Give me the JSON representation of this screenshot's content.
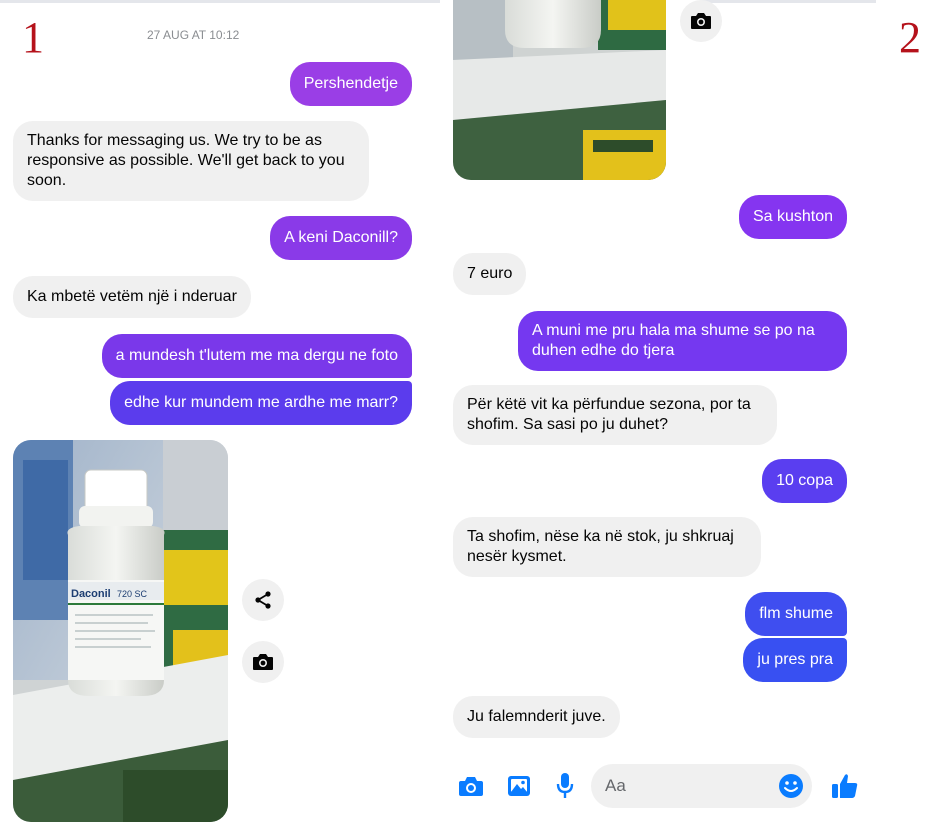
{
  "colors": {
    "outgoing_purple": "#8a3cf0",
    "outgoing_blue": "#3b4ff0",
    "incoming_bg": "#f0f0f0",
    "accent_blue": "#0a7cff",
    "panel_number_red": "#b5121b"
  },
  "panel1": {
    "number": "1",
    "timestamp": "27 AUG AT 10:12",
    "messages": [
      {
        "dir": "out",
        "text": "Pershendetje"
      },
      {
        "dir": "in",
        "text": "Thanks for messaging us. We try to be as responsive as possible. We'll get back to you soon."
      },
      {
        "dir": "out",
        "text": "A keni Daconill?"
      },
      {
        "dir": "in",
        "text": "Ka mbetë vetëm një i nderuar"
      },
      {
        "dir": "out",
        "text": "a mundesh t'lutem me ma dergu ne foto"
      },
      {
        "dir": "out",
        "text": "edhe kur mundem me ardhe me marr?"
      }
    ],
    "photo": {
      "bottle_brand": "Daconil",
      "bottle_label": "720 SC"
    },
    "photo_actions": {
      "share_icon": "share-icon",
      "camera_icon": "camera-icon"
    }
  },
  "panel2": {
    "number": "2",
    "top_camera_icon": "camera-icon",
    "messages": [
      {
        "dir": "out",
        "text": "Sa kushton"
      },
      {
        "dir": "in",
        "text": "7 euro"
      },
      {
        "dir": "out",
        "text": "A muni me pru hala ma shume se po na duhen edhe do tjera"
      },
      {
        "dir": "in",
        "text": "Për këtë vit ka përfundue sezona, por ta shofim. Sa sasi po ju duhet?"
      },
      {
        "dir": "out",
        "text": "10 copa"
      },
      {
        "dir": "in",
        "text": "Ta shofim, nëse ka në stok, ju shkruaj nesër kysmet."
      },
      {
        "dir": "out",
        "text": "flm shume"
      },
      {
        "dir": "out",
        "text": "ju pres pra"
      },
      {
        "dir": "in",
        "text": "Ju falemnderit juve."
      }
    ],
    "composer": {
      "placeholder": "Aa",
      "icons": [
        "camera-icon",
        "image-icon",
        "microphone-icon",
        "emoji-icon",
        "thumbs-up-icon"
      ]
    }
  }
}
